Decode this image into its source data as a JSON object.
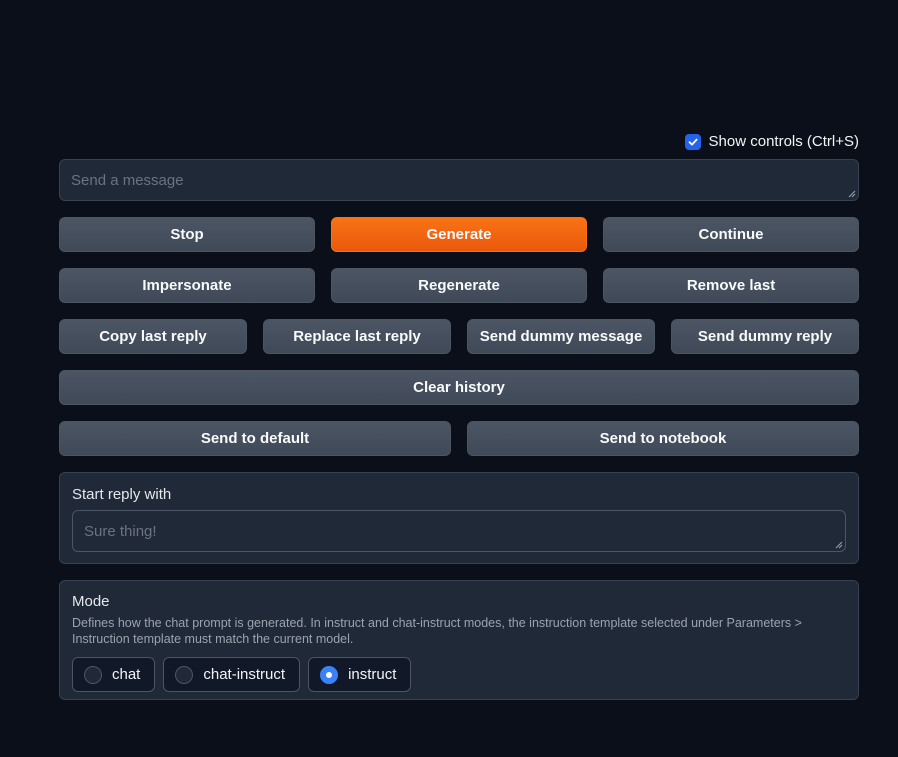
{
  "show_controls": {
    "label": "Show controls (Ctrl+S)",
    "checked": true
  },
  "message_input": {
    "placeholder": "Send a message",
    "value": ""
  },
  "buttons": {
    "stop": "Stop",
    "generate": "Generate",
    "continue": "Continue",
    "impersonate": "Impersonate",
    "regenerate": "Regenerate",
    "remove_last": "Remove last",
    "copy_last_reply": "Copy last reply",
    "replace_last_reply": "Replace last reply",
    "send_dummy_message": "Send dummy message",
    "send_dummy_reply": "Send dummy reply",
    "clear_history": "Clear history",
    "send_to_default": "Send to default",
    "send_to_notebook": "Send to notebook"
  },
  "start_reply": {
    "label": "Start reply with",
    "placeholder": "Sure thing!",
    "value": ""
  },
  "mode": {
    "label": "Mode",
    "description": "Defines how the chat prompt is generated. In instruct and chat-instruct modes, the instruction template selected under Parameters > Instruction template must match the current model.",
    "options": [
      "chat",
      "chat-instruct",
      "instruct"
    ],
    "selected": "instruct"
  },
  "colors": {
    "accent": "#f97316",
    "checkbox": "#2563eb",
    "radio_selected": "#3b82f6",
    "background": "#0b0f19"
  }
}
